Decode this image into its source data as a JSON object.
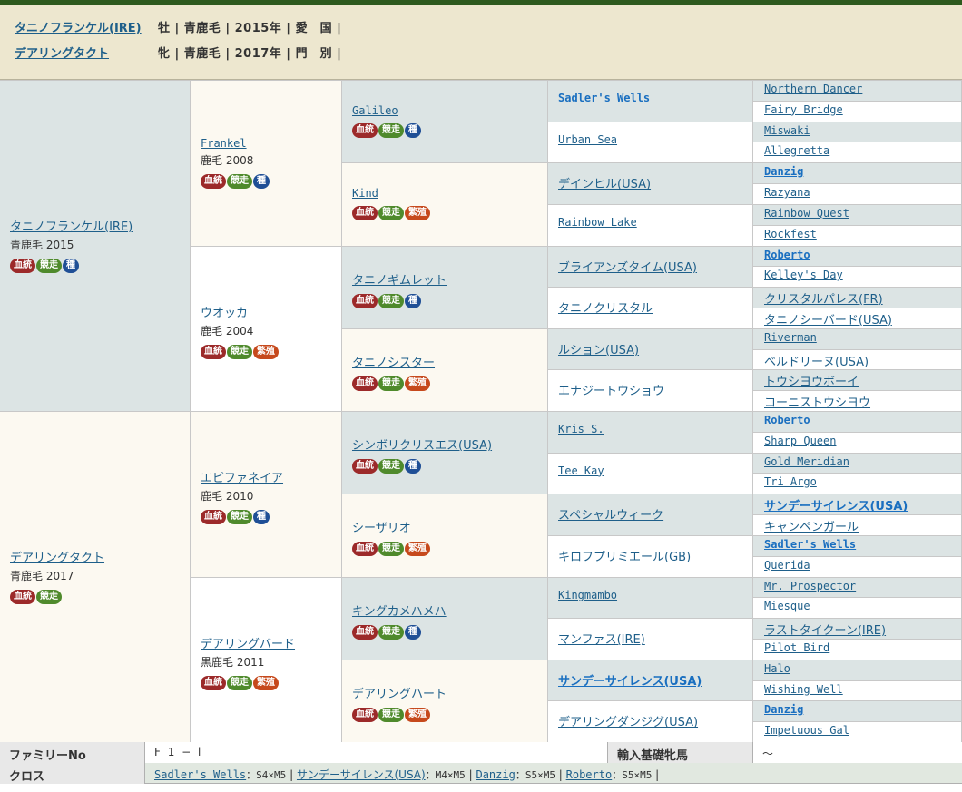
{
  "header": {
    "horses": [
      {
        "name": "タニノフランケル(IRE)",
        "info": "牡 | 青鹿毛 | 2015年 | 愛　国 |"
      },
      {
        "name": "デアリングタクト",
        "info": "牝 | 青鹿毛 | 2017年 | 門　別 |"
      }
    ]
  },
  "pedigree": {
    "g1": [
      {
        "name": "タニノフランケル(IRE)",
        "coat": "青鹿毛 2015",
        "badges": [
          "血統",
          "競走",
          "種"
        ]
      },
      {
        "name": "デアリングタクト",
        "coat": "青鹿毛 2017",
        "badges": [
          "血統",
          "競走"
        ]
      }
    ],
    "g2": [
      {
        "name": "Frankel",
        "coat": "鹿毛 2008",
        "badges": [
          "血統",
          "競走",
          "種"
        ]
      },
      {
        "name": "ウオッカ",
        "coat": "鹿毛 2004",
        "badges": [
          "血統",
          "競走",
          "繁殖"
        ]
      },
      {
        "name": "エピファネイア",
        "coat": "鹿毛 2010",
        "badges": [
          "血統",
          "競走",
          "種"
        ]
      },
      {
        "name": "デアリングバード",
        "coat": "黒鹿毛 2011",
        "badges": [
          "血統",
          "競走",
          "繁殖"
        ]
      }
    ],
    "g3": [
      {
        "name": "Galileo",
        "badges": [
          "血統",
          "競走",
          "種"
        ]
      },
      {
        "name": "Kind",
        "badges": [
          "血統",
          "競走",
          "繁殖"
        ]
      },
      {
        "name": "タニノギムレット",
        "badges": [
          "血統",
          "競走",
          "種"
        ]
      },
      {
        "name": "タニノシスター",
        "badges": [
          "血統",
          "競走",
          "繁殖"
        ]
      },
      {
        "name": "シンボリクリスエス(USA)",
        "badges": [
          "血統",
          "競走",
          "種"
        ]
      },
      {
        "name": "シーザリオ",
        "badges": [
          "血統",
          "競走",
          "繁殖"
        ]
      },
      {
        "name": "キングカメハメハ",
        "badges": [
          "血統",
          "競走",
          "種"
        ]
      },
      {
        "name": "デアリングハート",
        "badges": [
          "血統",
          "競走",
          "繁殖"
        ]
      }
    ],
    "g4": [
      {
        "name": "Sadler's Wells",
        "bold": true
      },
      {
        "name": "Urban Sea",
        "bold": false
      },
      {
        "name": "デインヒル(USA)",
        "bold": false
      },
      {
        "name": "Rainbow Lake",
        "bold": false
      },
      {
        "name": "ブライアンズタイム(USA)",
        "bold": false
      },
      {
        "name": "タニノクリスタル",
        "bold": false
      },
      {
        "name": "ルション(USA)",
        "bold": false
      },
      {
        "name": "エナジートウショウ",
        "bold": false
      },
      {
        "name": "Kris S.",
        "bold": false
      },
      {
        "name": "Tee Kay",
        "bold": false
      },
      {
        "name": "スペシャルウィーク",
        "bold": false
      },
      {
        "name": "キロフプリミエール(GB)",
        "bold": false
      },
      {
        "name": "Kingmambo",
        "bold": false
      },
      {
        "name": "マンファス(IRE)",
        "bold": false
      },
      {
        "name": "サンデーサイレンス(USA)",
        "bold": true
      },
      {
        "name": "デアリングダンジグ(USA)",
        "bold": false
      }
    ],
    "g5": [
      {
        "name": "Northern Dancer",
        "bold": false
      },
      {
        "name": "Fairy Bridge",
        "bold": false
      },
      {
        "name": "Miswaki",
        "bold": false
      },
      {
        "name": "Allegretta",
        "bold": false
      },
      {
        "name": "Danzig",
        "bold": true
      },
      {
        "name": "Razyana",
        "bold": false
      },
      {
        "name": "Rainbow Quest",
        "bold": false
      },
      {
        "name": "Rockfest",
        "bold": false
      },
      {
        "name": "Roberto",
        "bold": true
      },
      {
        "name": "Kelley's Day",
        "bold": false
      },
      {
        "name": "クリスタルパレス(FR)",
        "bold": false
      },
      {
        "name": "タニノシーバード(USA)",
        "bold": false
      },
      {
        "name": "Riverman",
        "bold": false
      },
      {
        "name": "ベルドリーヌ(USA)",
        "bold": false
      },
      {
        "name": "トウシヨウボーイ",
        "bold": false
      },
      {
        "name": "コーニストウシヨウ",
        "bold": false
      },
      {
        "name": "Roberto",
        "bold": true
      },
      {
        "name": "Sharp Queen",
        "bold": false
      },
      {
        "name": "Gold Meridian",
        "bold": false
      },
      {
        "name": "Tri Argo",
        "bold": false
      },
      {
        "name": "サンデーサイレンス(USA)",
        "bold": true
      },
      {
        "name": "キャンペンガール",
        "bold": false
      },
      {
        "name": "Sadler's Wells",
        "bold": true
      },
      {
        "name": "Querida",
        "bold": false
      },
      {
        "name": "Mr. Prospector",
        "bold": false
      },
      {
        "name": "Miesque",
        "bold": false
      },
      {
        "name": "ラストタイクーン(IRE)",
        "bold": false
      },
      {
        "name": "Pilot Bird",
        "bold": false
      },
      {
        "name": "Halo",
        "bold": false
      },
      {
        "name": "Wishing Well",
        "bold": false
      },
      {
        "name": "Danzig",
        "bold": true
      },
      {
        "name": "Impetuous Gal",
        "bold": false
      }
    ]
  },
  "footer": {
    "family_label": "ファミリーNo",
    "family_value": "F 1 − l",
    "import_label": "輸入基礎牝馬",
    "import_value": "〜",
    "cross_label": "クロス",
    "crosses": [
      {
        "name": "Sadler's Wells",
        "value": "：S4×M5"
      },
      {
        "name": "サンデーサイレンス(USA)",
        "value": "：M4×M5"
      },
      {
        "name": "Danzig",
        "value": "：S5×M5"
      },
      {
        "name": "Roberto",
        "value": "：S5×M5"
      }
    ]
  },
  "colors": {
    "topbar": "#2e5a1e",
    "header_bg": "#ede7cf",
    "link": "#1e5f8a",
    "badge_blood": "#9c2a2a",
    "badge_race": "#4f8a2c",
    "badge_stud": "#1f4f96",
    "badge_brood": "#c6491c"
  }
}
